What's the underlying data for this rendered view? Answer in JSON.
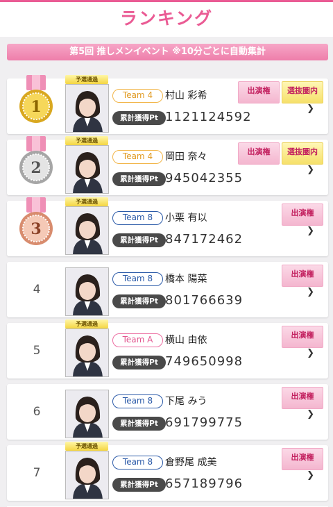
{
  "header": {
    "title": "ランキング"
  },
  "banner": {
    "text": "第5回 推しメンイベント ※10分ごとに自動集計"
  },
  "labels": {
    "prelim": "予選通過",
    "points_label": "累計獲得Pt"
  },
  "colors": {
    "accent": "#ea5b94",
    "team8": "#2b5aa8",
    "team4": "#e09a22",
    "teamA": "#e2568f"
  },
  "rankings": [
    {
      "rank": "1",
      "prelim": true,
      "team": "Team 4",
      "name": "村山 彩希",
      "points": "1121124592",
      "badges": [
        "出演権",
        "選抜圏内"
      ]
    },
    {
      "rank": "2",
      "prelim": true,
      "team": "Team 4",
      "name": "岡田 奈々",
      "points": "945042355",
      "badges": [
        "出演権",
        "選抜圏内"
      ]
    },
    {
      "rank": "3",
      "prelim": true,
      "team": "Team 8",
      "name": "小栗 有以",
      "points": "847172462",
      "badges": [
        "出演権"
      ]
    },
    {
      "rank": "4",
      "prelim": false,
      "team": "Team 8",
      "name": "橋本 陽菜",
      "points": "801766639",
      "badges": [
        "出演権"
      ]
    },
    {
      "rank": "5",
      "prelim": true,
      "team": "Team A",
      "name": "横山 由依",
      "points": "749650998",
      "badges": [
        "出演権"
      ]
    },
    {
      "rank": "6",
      "prelim": false,
      "team": "Team 8",
      "name": "下尾 みう",
      "points": "691799775",
      "badges": [
        "出演権"
      ]
    },
    {
      "rank": "7",
      "prelim": true,
      "team": "Team 8",
      "name": "倉野尾 成美",
      "points": "657189796",
      "badges": [
        "出演権"
      ]
    }
  ]
}
